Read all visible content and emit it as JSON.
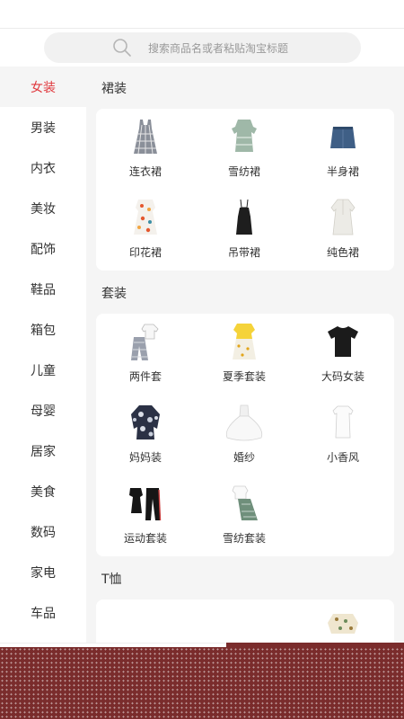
{
  "search": {
    "placeholder": "搜索商品名或者粘贴淘宝标题",
    "icon": "search-icon"
  },
  "sidebar": {
    "active_color": "#e0393e",
    "items": [
      {
        "label": "女装",
        "active": true
      },
      {
        "label": "男装"
      },
      {
        "label": "内衣"
      },
      {
        "label": "美妆"
      },
      {
        "label": "配饰"
      },
      {
        "label": "鞋品"
      },
      {
        "label": "箱包"
      },
      {
        "label": "儿童"
      },
      {
        "label": "母婴"
      },
      {
        "label": "居家"
      },
      {
        "label": "美食"
      },
      {
        "label": "数码"
      },
      {
        "label": "家电"
      },
      {
        "label": "车品"
      }
    ]
  },
  "sections": [
    {
      "title": "裙装",
      "items": [
        {
          "label": "连衣裙",
          "icon": "plaid-dress-icon"
        },
        {
          "label": "雪纺裙",
          "icon": "chiffon-dress-icon"
        },
        {
          "label": "半身裙",
          "icon": "denim-skirt-icon"
        },
        {
          "label": "印花裙",
          "icon": "print-dress-icon"
        },
        {
          "label": "吊带裙",
          "icon": "slip-dress-icon"
        },
        {
          "label": "纯色裙",
          "icon": "white-dress-icon"
        }
      ]
    },
    {
      "title": "套装",
      "items": [
        {
          "label": "两件套",
          "icon": "two-piece-icon"
        },
        {
          "label": "夏季套装",
          "icon": "summer-set-icon"
        },
        {
          "label": "大码女装",
          "icon": "black-tee-icon"
        },
        {
          "label": "妈妈装",
          "icon": "floral-jacket-icon"
        },
        {
          "label": "婚纱",
          "icon": "wedding-gown-icon"
        },
        {
          "label": "小香风",
          "icon": "white-blouse-icon"
        },
        {
          "label": "运动套装",
          "icon": "sport-set-icon"
        },
        {
          "label": "雪纺套装",
          "icon": "chiffon-set-icon"
        }
      ]
    },
    {
      "title": "T恤"
    }
  ],
  "tabbar": {
    "icons": [
      "home-icon",
      "crown-icon",
      "diamond-icon"
    ]
  }
}
